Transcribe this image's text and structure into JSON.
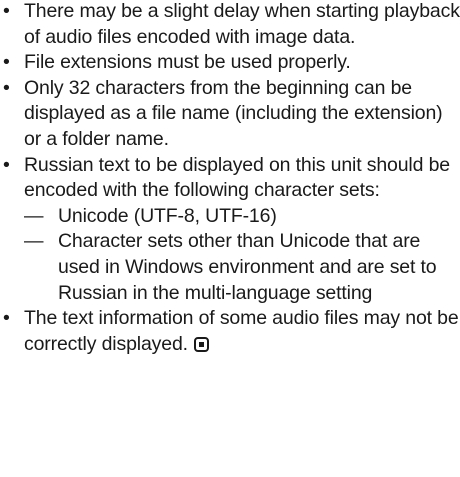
{
  "bullet_symbol": "•",
  "dash_symbol": "—",
  "items": [
    {
      "text": "There may be a slight delay when starting playback of audio files encoded with image data."
    },
    {
      "text": "File extensions must be used properly."
    },
    {
      "text": "Only 32 characters from the beginning can be displayed as a file name (including the extension) or a folder name."
    },
    {
      "text": "Russian text to be displayed on this unit should be encoded with the following character sets:",
      "subitems": [
        {
          "text": "Unicode (UTF-8, UTF-16)"
        },
        {
          "text": "Character sets other than Unicode that are used in Windows environment and are set to Russian in the multi-language setting"
        }
      ]
    },
    {
      "text": "The text information of some audio files may not be correctly displayed.",
      "end_icon": "end-of-section-icon"
    }
  ]
}
